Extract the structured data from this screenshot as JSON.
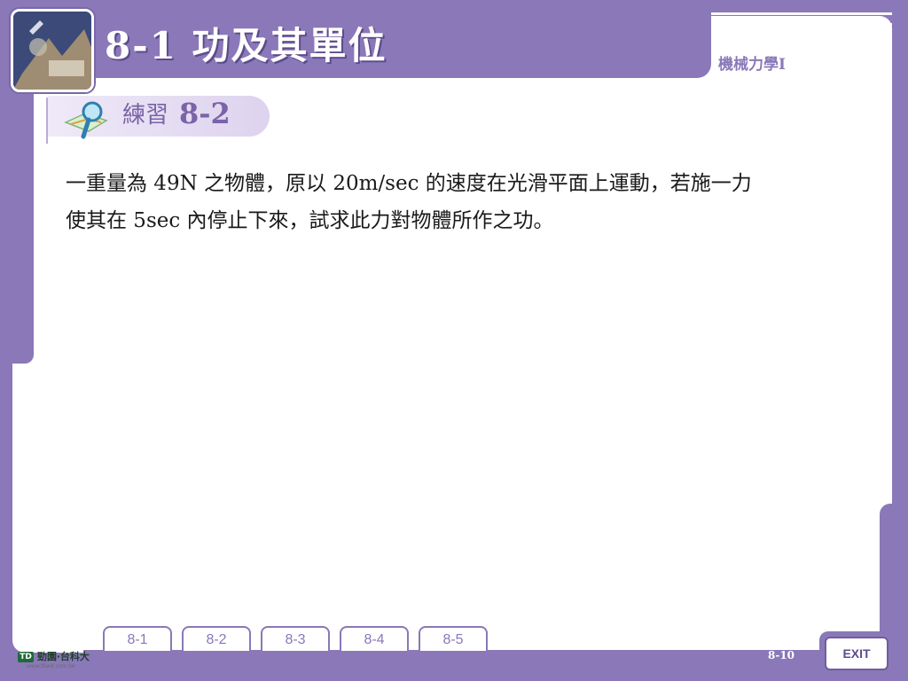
{
  "header": {
    "title": "8-1  功及其單位",
    "subject": "機械力學I"
  },
  "practice": {
    "label": "練習",
    "number": "8-2"
  },
  "question": {
    "line1": "一重量為 49N 之物體，原以 20m/sec 的速度在光滑平面上運動，若施一力",
    "line2": "使其在 5sec 內停止下來，試求此力對物體所作之功。"
  },
  "nav": {
    "tabs": [
      {
        "label": "8-1"
      },
      {
        "label": "8-2"
      },
      {
        "label": "8-3"
      },
      {
        "label": "8-4"
      },
      {
        "label": "8-5"
      }
    ]
  },
  "footer": {
    "logo_text": "勁園‧台科大",
    "logo_mark": "TD",
    "logo_url": "www.tkwd.com.tw",
    "page_number": "8-10",
    "exit_label": "EXIT"
  },
  "colors": {
    "frame": "#8a78b8",
    "panel": "#ffffff",
    "accent_text": "#7a63a8"
  },
  "icons": {
    "practice": "magnifier-map-icon",
    "thumbnail": "machinery-photo"
  }
}
